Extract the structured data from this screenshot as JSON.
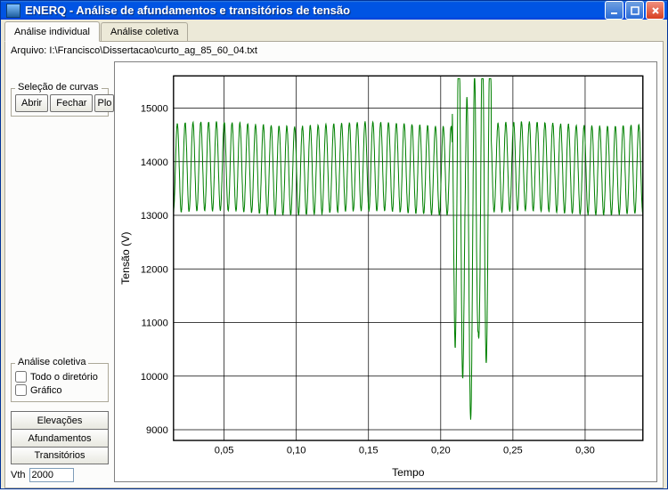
{
  "window": {
    "title": "ENERQ - Análise de afundamentos e transitórios de tensão"
  },
  "tabs": [
    {
      "label": "Análise individual",
      "active": true
    },
    {
      "label": "Análise coletiva",
      "active": false
    }
  ],
  "file_line": "Arquivo: I:\\Francisco\\Dissertacao\\curto_ag_85_60_04.txt",
  "curve_group": {
    "title": "Seleção de curvas",
    "open": "Abrir",
    "close": "Fechar",
    "plot": "Plo"
  },
  "collective_group": {
    "title": "Análise coletiva",
    "check_all_dir": "Todo o diretório",
    "check_graphic": "Gráfico"
  },
  "stack": {
    "elev": "Elevações",
    "sag": "Afundamentos",
    "trans": "Transitórios"
  },
  "vth": {
    "label": "Vth",
    "value": "2000"
  },
  "chart_data": {
    "type": "line",
    "xlabel": "Tempo",
    "ylabel": "Tensão (V)",
    "xlim": [
      0.015,
      0.34
    ],
    "ylim": [
      8800,
      15600
    ],
    "xticks": [
      0.05,
      0.1,
      0.15,
      0.2,
      0.25,
      0.3
    ],
    "yticks": [
      9000,
      10000,
      11000,
      12000,
      13000,
      14000,
      15000
    ],
    "normal_band": {
      "low": 13050,
      "high": 14700
    },
    "disturbance": {
      "start": 0.208,
      "end": 0.235,
      "min": 9150,
      "max": 15450
    },
    "cycles": 60
  }
}
